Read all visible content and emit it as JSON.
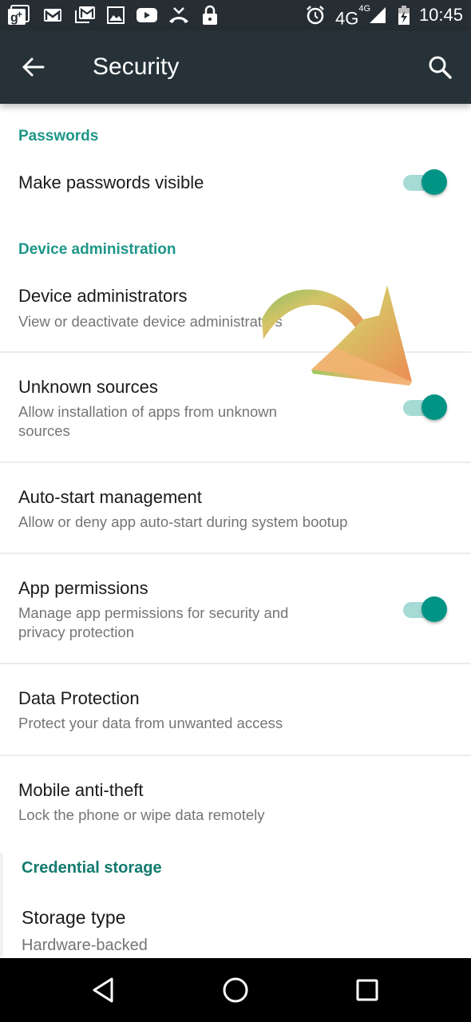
{
  "status_bar": {
    "left_icons": [
      "google-plus-icon",
      "gmail-icon",
      "gmail-multiple-icon",
      "image-icon",
      "youtube-icon",
      "missed-call-icon",
      "lock-icon"
    ],
    "right_icons": [
      "alarm-icon",
      "signal-icon",
      "battery-charging-icon"
    ],
    "network": "4G",
    "network_sup": "4G",
    "time": "10:45"
  },
  "app_bar": {
    "title": "Security",
    "back_icon": "arrow-back-icon",
    "search_icon": "search-icon"
  },
  "sections": [
    {
      "header": "Passwords",
      "items": [
        {
          "title": "Make passwords visible",
          "summary": "",
          "toggle": true,
          "checked": true
        }
      ]
    },
    {
      "header": "Device administration",
      "items": [
        {
          "title": "Device administrators",
          "summary": "View or deactivate device administrators",
          "toggle": false
        },
        {
          "title": "Unknown sources",
          "summary": "Allow installation of apps from unknown sources",
          "toggle": true,
          "checked": true
        },
        {
          "title": "Auto-start management",
          "summary": "Allow or deny app auto-start during system bootup",
          "toggle": false
        },
        {
          "title": "App permissions",
          "summary": "Manage app permissions for security and privacy protection",
          "toggle": true,
          "checked": true
        },
        {
          "title": "Data Protection",
          "summary": "Protect your data from unwanted access",
          "toggle": false
        },
        {
          "title": "Mobile anti-theft",
          "summary": "Lock the phone or wipe data remotely",
          "toggle": false
        }
      ]
    },
    {
      "header": "Credential storage",
      "items": [
        {
          "title": "Storage type",
          "summary": "Hardware-backed",
          "toggle": false
        }
      ]
    }
  ],
  "overlay": {
    "annotation": "curved-arrow-pointing-to-unknown-sources-toggle"
  },
  "nav_bar": {
    "back": "nav-back-icon",
    "home": "nav-home-icon",
    "recents": "nav-recents-icon"
  },
  "colors": {
    "accent": "#009485",
    "section_header": "#1e9688",
    "app_bar": "#263238",
    "status_bar": "#262d33"
  }
}
